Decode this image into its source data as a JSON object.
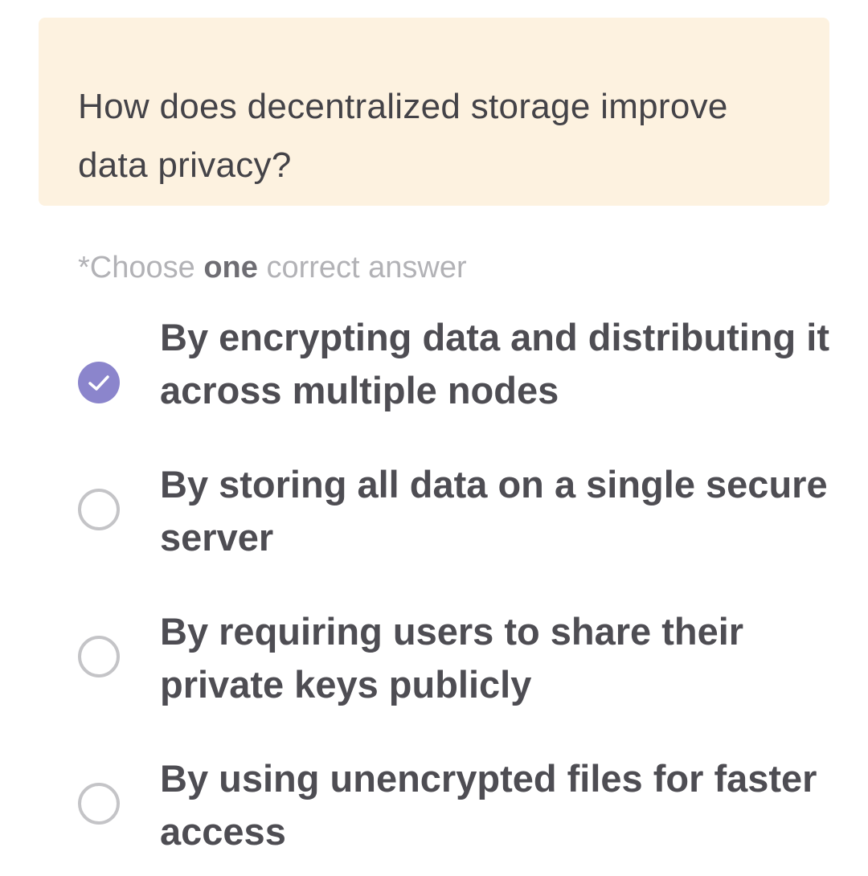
{
  "question": {
    "text": "How does decentralized storage improve data privacy?"
  },
  "instruction": {
    "prefix": "*Choose ",
    "emphasis": "one",
    "suffix": " correct answer"
  },
  "options": [
    {
      "label": "By encrypting data and distributing it across multiple nodes",
      "selected": true
    },
    {
      "label": "By storing all data on a single secure server",
      "selected": false
    },
    {
      "label": "By requiring users to share their private keys publicly",
      "selected": false
    },
    {
      "label": "By using unencrypted files for faster access",
      "selected": false
    }
  ],
  "colors": {
    "question_background": "#fdf2e0",
    "selected_accent": "#8b85cc",
    "unselected_ring": "#c4c4c7",
    "option_text": "#4e4d53",
    "instruction_text": "#b2b2b6"
  },
  "icons": {
    "selected": "check-icon",
    "unselected": "empty-radio-icon"
  }
}
